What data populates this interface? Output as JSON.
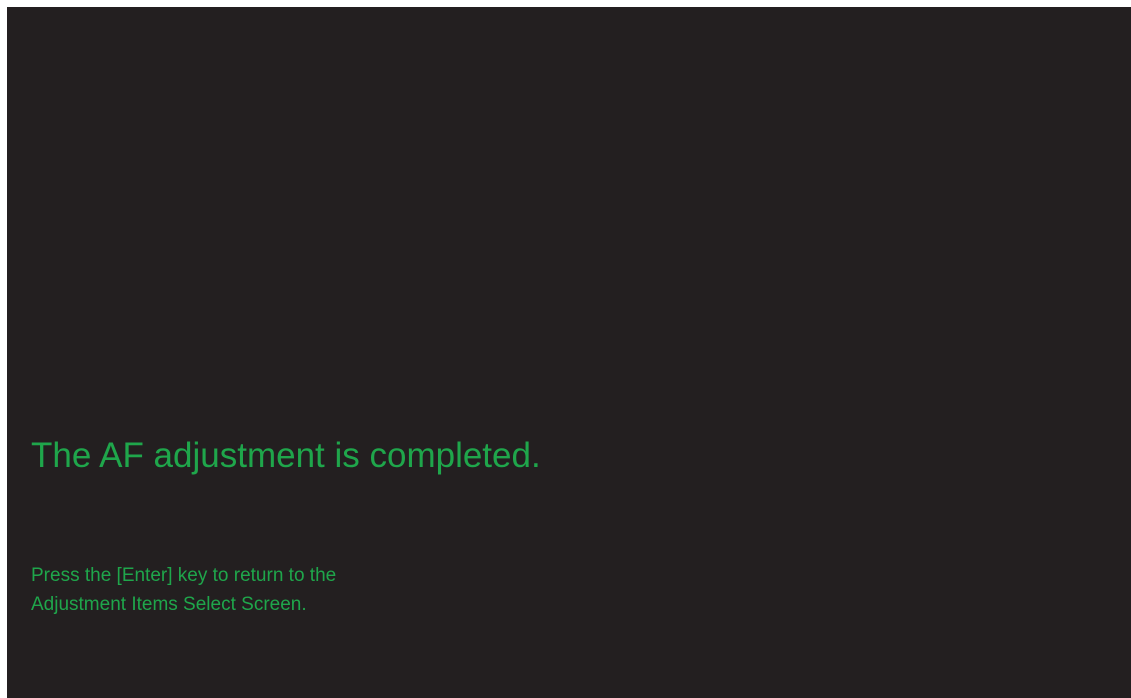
{
  "screen": {
    "message_title": "The AF adjustment is completed.",
    "instruction_lines": [
      "Press the [Enter] key to return to the",
      "Adjustment Items Select Screen."
    ]
  },
  "colors": {
    "background": "#231f20",
    "text": "#1fa64b"
  }
}
